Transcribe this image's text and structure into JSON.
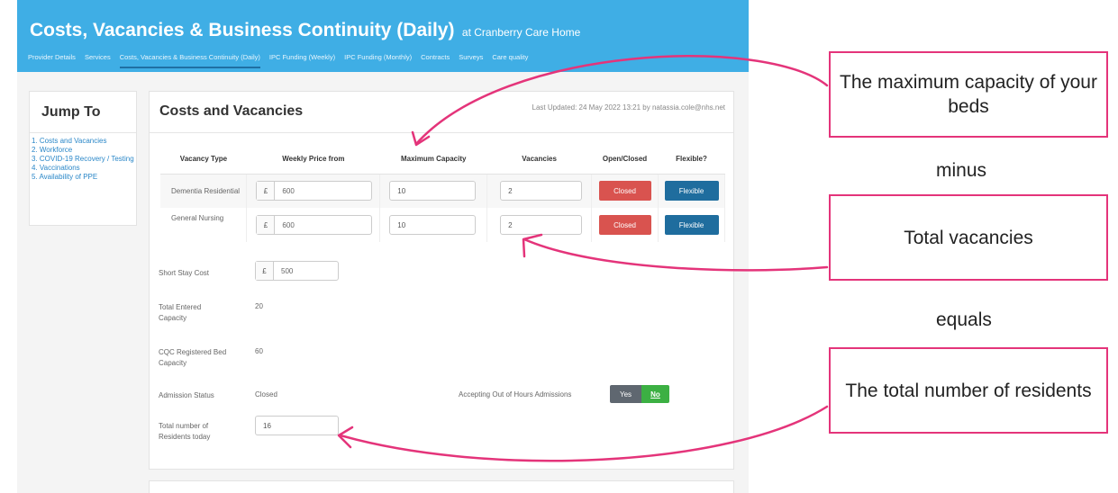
{
  "header": {
    "title": "Costs, Vacancies & Business Continuity (Daily)",
    "subtitle": "at Cranberry Care Home",
    "nav": [
      "Provider Details",
      "Services",
      "Costs, Vacancies & Business Continuity (Daily)",
      "IPC Funding (Weekly)",
      "IPC Funding (Monthly)",
      "Contracts",
      "Surveys",
      "Care quality"
    ]
  },
  "jump": {
    "title": "Jump To",
    "items": [
      "1. Costs and Vacancies",
      "2. Workforce",
      "3. COVID-19 Recovery / Testing",
      "4. Vaccinations",
      "5. Availability of PPE"
    ]
  },
  "panel": {
    "title": "Costs and Vacancies",
    "last_updated": "Last Updated: 24 May 2022 13:21 by natassia.cole@nhs.net",
    "columns": [
      "Vacancy Type",
      "Weekly Price from",
      "Maximum Capacity",
      "Vacancies",
      "Open/Closed",
      "Flexible?"
    ],
    "rows": [
      {
        "type": "Dementia Residential",
        "currency": "£",
        "price": "600",
        "capacity": "10",
        "vacancies": "2",
        "status": "Closed",
        "flexible": "Flexible"
      },
      {
        "type": "General Nursing",
        "currency": "£",
        "price": "600",
        "capacity": "10",
        "vacancies": "2",
        "status": "Closed",
        "flexible": "Flexible"
      }
    ],
    "short_stay_label": "Short Stay Cost",
    "short_stay_currency": "£",
    "short_stay_value": "500",
    "total_capacity_label": "Total Entered Capacity",
    "total_capacity_value": "20",
    "cqc_label": "CQC Registered Bed Capacity",
    "cqc_value": "60",
    "admission_label": "Admission Status",
    "admission_value": "Closed",
    "ooh_label": "Accepting Out of Hours Admissions",
    "ooh_yes": "Yes",
    "ooh_no": "No",
    "residents_label": "Total number of Residents today",
    "residents_value": "16"
  },
  "annotations": {
    "box1": "The maximum capacity of your beds",
    "minus": "minus",
    "box2": "Total vacancies",
    "equals": "equals",
    "box3": "The total number of residents"
  },
  "colors": {
    "header": "#3faee5",
    "closed": "#d9534f",
    "flexible": "#1f6d9e",
    "annotation": "#e4347a",
    "yes": "#5f6770",
    "no": "#3cb043"
  }
}
